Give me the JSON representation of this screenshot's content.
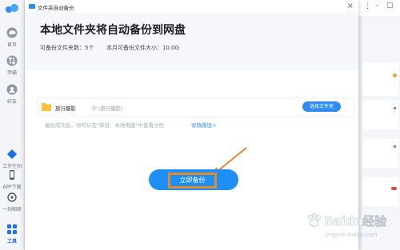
{
  "sidebar": {
    "items": [
      {
        "label": "首页"
      },
      {
        "label": "传输"
      },
      {
        "label": "好友"
      },
      {
        "label": "工作空间"
      },
      {
        "label": "APP下载"
      },
      {
        "label": "一刻相册"
      },
      {
        "label": "工具"
      }
    ]
  },
  "dialog": {
    "window_title": "文件夹自动备份",
    "heading": "本地文件夹将自动备份到网盘",
    "stats": {
      "folder_count": "可备份文件夹数：5个",
      "monthly_size": "本月可备份文件大小：10.0G"
    },
    "folder": {
      "name": "旅行摄影",
      "path": "(F:\\旅行摄影)",
      "select_button": "选择文件夹"
    },
    "note": "备份成功后，你可以在\"来自：本地电脑\"中查看文档",
    "note_link": "修改路径>",
    "backup_button": "立即备份"
  },
  "watermark": {
    "text": "Baidu经验",
    "sub": "jingyan.baidu.com"
  },
  "colors": {
    "accent": "#1e8ff6",
    "highlight": "#e38a2c",
    "folder": "#f7c23a"
  }
}
